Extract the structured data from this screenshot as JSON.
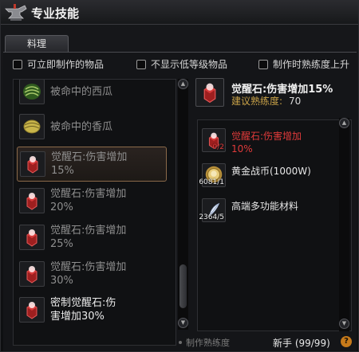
{
  "window": {
    "title": "专业技能"
  },
  "tabs": [
    {
      "label": "料理"
    }
  ],
  "filters": [
    {
      "label": "可立即制作的物品"
    },
    {
      "label": "不显示低等级物品"
    },
    {
      "label": "制作时熟练度上升"
    }
  ],
  "recipe_list": [
    {
      "name": "被命中的西瓜",
      "icon": "watermelon-icon",
      "state": "dim"
    },
    {
      "name": "被命中的香瓜",
      "icon": "melon-icon",
      "state": "dim"
    },
    {
      "name": "觉醒石:伤害增加15%",
      "line1": "觉醒石:伤害增加",
      "line2": "15%",
      "icon": "awakening-stone-icon",
      "state": "selected"
    },
    {
      "name": "觉醒石:伤害增加20%",
      "line1": "觉醒石:伤害增加",
      "line2": "20%",
      "icon": "awakening-stone-icon",
      "state": "dim"
    },
    {
      "name": "觉醒石:伤害增加25%",
      "line1": "觉醒石:伤害增加",
      "line2": "25%",
      "icon": "awakening-stone-icon",
      "state": "dim"
    },
    {
      "name": "觉醒石:伤害增加30%",
      "line1": "觉醒石:伤害增加",
      "line2": "30%",
      "icon": "awakening-stone-icon",
      "state": "dim"
    },
    {
      "name": "密制觉醒石:伤害增加30%",
      "line1": "密制觉醒石:伤",
      "line2": "害增加30%",
      "icon": "awakening-stone-icon",
      "state": "bright"
    }
  ],
  "detail": {
    "name": "觉醒石:伤害增加15%",
    "proficiency_label": "建议熟练度:",
    "proficiency_value": "70",
    "icon": "awakening-stone-icon"
  },
  "materials": [
    {
      "name_line1": "觉醒石:伤害增加",
      "name_line2": "10%",
      "count": "0/2",
      "icon": "awakening-stone-icon",
      "insufficient": true
    },
    {
      "name_line1": "黄金战币(1000W)",
      "name_line2": "",
      "count": "6081/1",
      "icon": "gold-coin-icon",
      "insufficient": false
    },
    {
      "name_line1": "高端多功能材料",
      "name_line2": "",
      "count": "2364/5",
      "icon": "feather-material-icon",
      "insufficient": false
    }
  ],
  "footer": {
    "label": "制作熟练度",
    "value": "新手 (99/99)",
    "help": "?"
  },
  "scroll": {
    "up": "▲",
    "down": "▼"
  },
  "colors": {
    "accent_gold": "#c9a248",
    "insufficient_red": "#e03a3a",
    "selected_border": "#8b6a4a",
    "help_orange": "#c77a1a"
  }
}
